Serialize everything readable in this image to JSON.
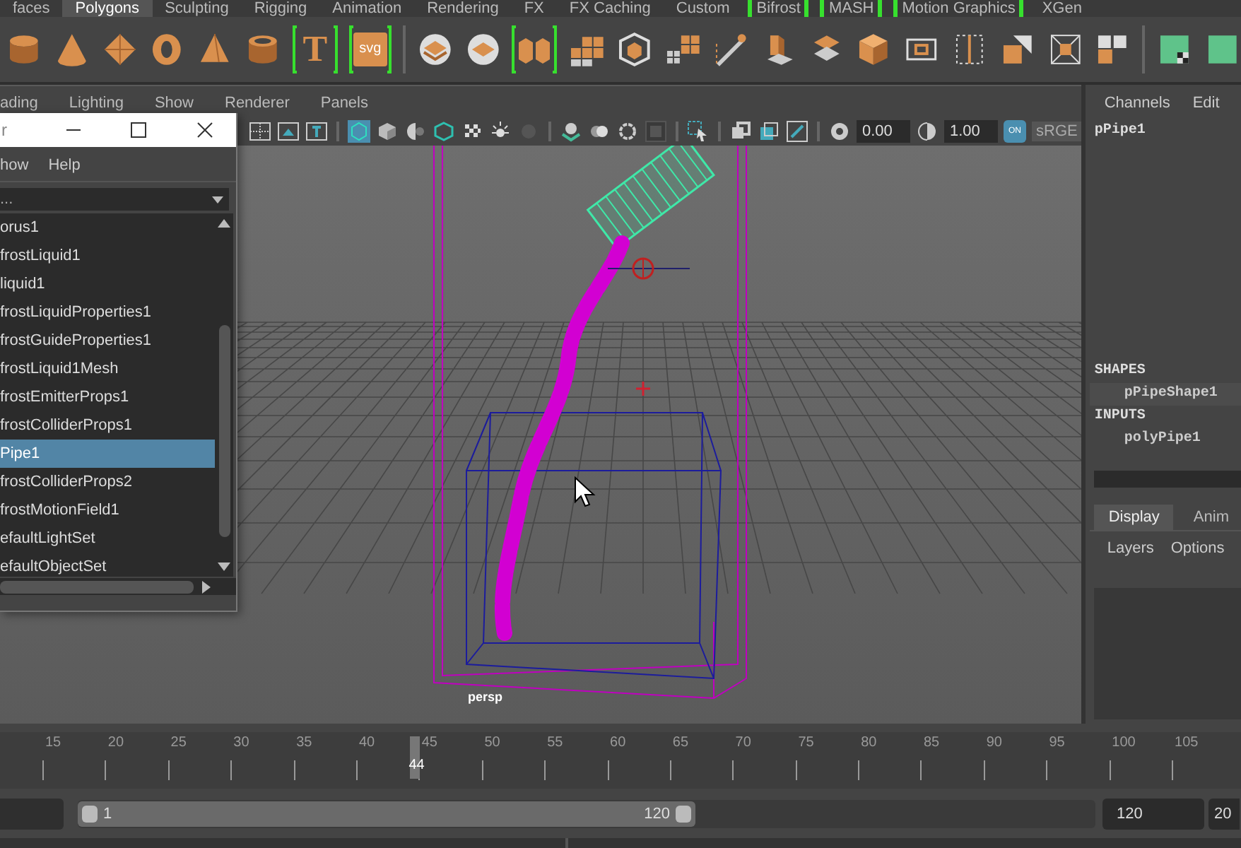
{
  "shelf": {
    "tabs": [
      {
        "label": "faces",
        "selected": false,
        "bracketed": false
      },
      {
        "label": "Polygons",
        "selected": true,
        "bracketed": false
      },
      {
        "label": "Sculpting",
        "selected": false,
        "bracketed": false
      },
      {
        "label": "Rigging",
        "selected": false,
        "bracketed": false
      },
      {
        "label": "Animation",
        "selected": false,
        "bracketed": false
      },
      {
        "label": "Rendering",
        "selected": false,
        "bracketed": false
      },
      {
        "label": "FX",
        "selected": false,
        "bracketed": false
      },
      {
        "label": "FX Caching",
        "selected": false,
        "bracketed": false
      },
      {
        "label": "Custom",
        "selected": false,
        "bracketed": false
      },
      {
        "label": "Bifrost",
        "selected": false,
        "bracketed": true
      },
      {
        "label": "MASH",
        "selected": false,
        "bracketed": true
      },
      {
        "label": "Motion Graphics",
        "selected": false,
        "bracketed": true
      },
      {
        "label": "XGen",
        "selected": false,
        "bracketed": false
      }
    ],
    "text_tools": [
      "T",
      "svg"
    ]
  },
  "viewport": {
    "menus": [
      "ading",
      "Lighting",
      "Show",
      "Renderer",
      "Panels"
    ],
    "exposure": "0.00",
    "gamma": "1.00",
    "toggle": {
      "label": "ON",
      "on": true
    },
    "color_space": "sRGE",
    "camera_label": "persp"
  },
  "outliner": {
    "title": "r",
    "menus": [
      "how",
      "Help"
    ],
    "filter": "...",
    "items": [
      {
        "label": "orus1",
        "selected": false
      },
      {
        "label": "frostLiquid1",
        "selected": false
      },
      {
        "label": "liquid1",
        "selected": false
      },
      {
        "label": "frostLiquidProperties1",
        "selected": false
      },
      {
        "label": "frostGuideProperties1",
        "selected": false
      },
      {
        "label": "frostLiquid1Mesh",
        "selected": false
      },
      {
        "label": "frostEmitterProps1",
        "selected": false
      },
      {
        "label": "frostColliderProps1",
        "selected": false
      },
      {
        "label": "Pipe1",
        "selected": true
      },
      {
        "label": "frostColliderProps2",
        "selected": false
      },
      {
        "label": "frostMotionField1",
        "selected": false
      },
      {
        "label": "efaultLightSet",
        "selected": false
      },
      {
        "label": "efaultObjectSet",
        "selected": false
      }
    ]
  },
  "channel_box": {
    "menus": [
      "Channels",
      "Edit"
    ],
    "object": "pPipe1",
    "sections": [
      {
        "heading": "SHAPES",
        "items": [
          "pPipeShape1"
        ]
      },
      {
        "heading": "INPUTS",
        "items": [
          "polyPipe1"
        ]
      }
    ]
  },
  "layer_editor": {
    "tabs": [
      {
        "label": "Display",
        "selected": true
      },
      {
        "label": "Anim",
        "selected": false
      }
    ],
    "menus": [
      "Layers",
      "Options"
    ]
  },
  "time_slider": {
    "ticks": [
      "15",
      "20",
      "25",
      "30",
      "35",
      "40",
      "45",
      "50",
      "55",
      "60",
      "65",
      "70",
      "75",
      "80",
      "85",
      "90",
      "95",
      "100",
      "105"
    ],
    "current": "44",
    "level": 0.334
  },
  "range": {
    "level": 0.607,
    "start": "1",
    "end": "120",
    "end_field": "120",
    "max_field": "20"
  }
}
